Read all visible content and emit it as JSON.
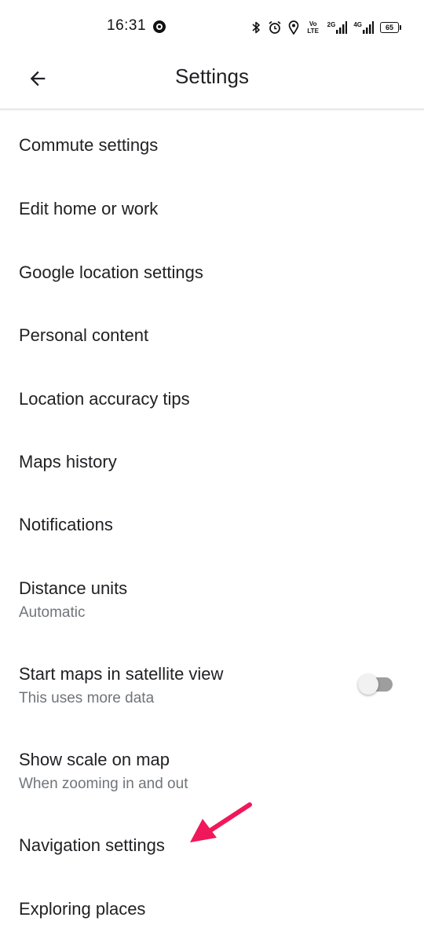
{
  "status_bar": {
    "time": "16:31",
    "net_volte": "Vo\nLTE",
    "net_2g": "2G",
    "net_4g": "4G",
    "battery": "65"
  },
  "app_bar": {
    "title": "Settings"
  },
  "settings": {
    "items": [
      {
        "label": "Commute settings"
      },
      {
        "label": "Edit home or work"
      },
      {
        "label": "Google location settings"
      },
      {
        "label": "Personal content"
      },
      {
        "label": "Location accuracy tips"
      },
      {
        "label": "Maps history"
      },
      {
        "label": "Notifications"
      },
      {
        "label": "Distance units",
        "sub": "Automatic"
      },
      {
        "label": "Start maps in satellite view",
        "sub": "This uses more data",
        "toggle": false
      },
      {
        "label": "Show scale on map",
        "sub": "When zooming in and out"
      },
      {
        "label": "Navigation settings"
      },
      {
        "label": "Exploring places"
      }
    ]
  },
  "colors": {
    "annotation_arrow": "#f0185a",
    "secondary_text": "#70757a",
    "toggle_off_track": "#9e9e9e"
  }
}
